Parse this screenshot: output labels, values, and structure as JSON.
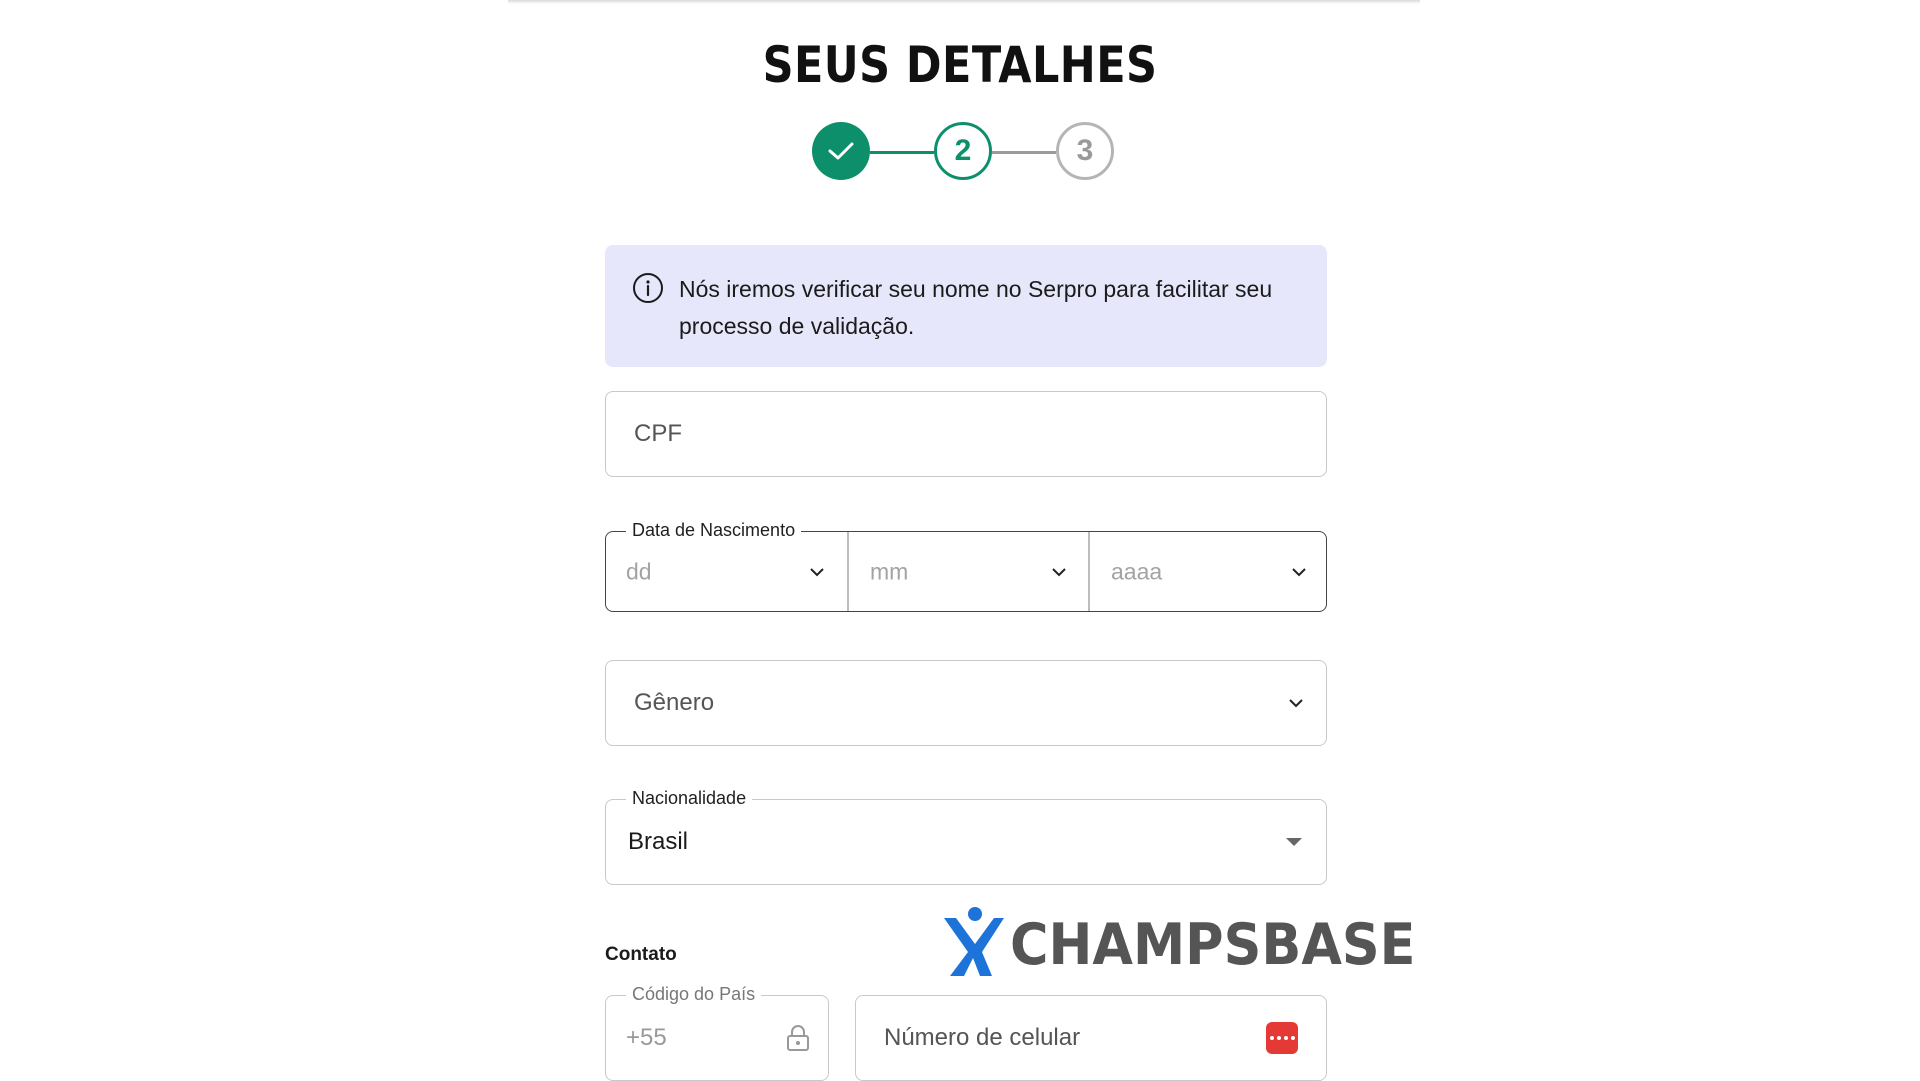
{
  "page": {
    "title": "SEUS DETALHES"
  },
  "stepper": {
    "steps": [
      {
        "label": "",
        "state": "completed"
      },
      {
        "label": "2",
        "state": "current"
      },
      {
        "label": "3",
        "state": "upcoming"
      }
    ],
    "colors": {
      "completed": "#0e8f6c",
      "upcoming": "#9a9a9a"
    }
  },
  "info_banner": {
    "text": "Nós iremos verificar seu nome no Serpro para facilitar seu processo de validação.",
    "background": "#e6e7fa",
    "icon": "info-icon"
  },
  "form": {
    "cpf": {
      "placeholder": "CPF"
    },
    "birth_date": {
      "legend": "Data de Nascimento",
      "day": {
        "placeholder": "dd"
      },
      "month": {
        "placeholder": "mm"
      },
      "year": {
        "placeholder": "aaaa"
      }
    },
    "gender": {
      "placeholder": "Gênero"
    },
    "nationality": {
      "legend": "Nacionalidade",
      "value": "Brasil"
    },
    "contact": {
      "section_label": "Contato",
      "country_code": {
        "legend": "Código do País",
        "value": "+55",
        "icon": "lock-icon"
      },
      "phone": {
        "placeholder": "Número de celular",
        "icon": "dots-icon"
      }
    }
  },
  "watermark": {
    "text": "CHAMPSBASE",
    "colors": {
      "figure": "#1e73d8",
      "text": "#555555"
    }
  }
}
